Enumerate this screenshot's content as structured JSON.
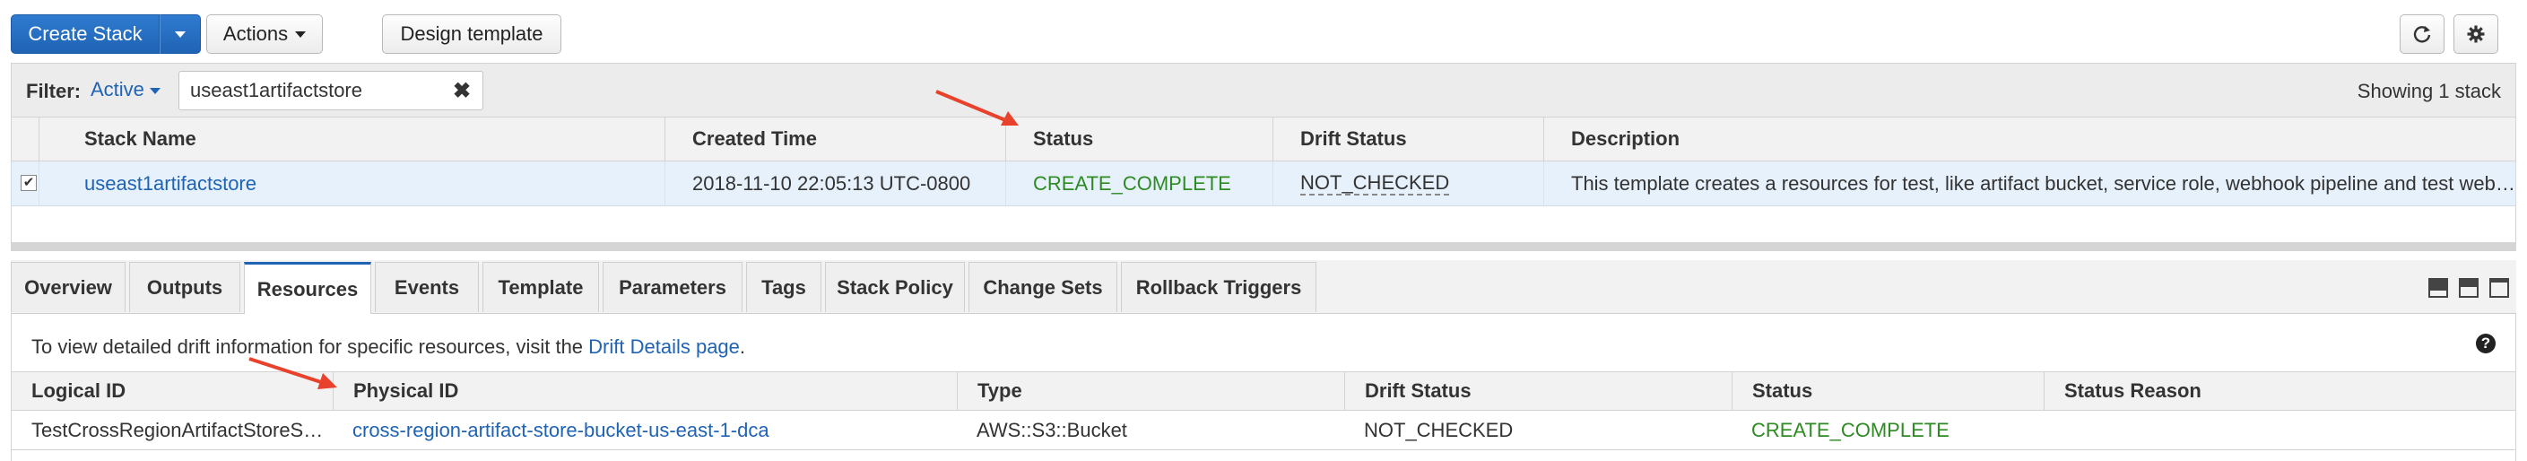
{
  "toolbar": {
    "create_stack": "Create Stack",
    "actions": "Actions",
    "design_template": "Design template",
    "refresh_icon": "refresh-icon",
    "settings_icon": "gear-icon"
  },
  "filter": {
    "label": "Filter:",
    "status_filter": "Active",
    "search_value": "useast1artifactstore",
    "clear_icon": "close-icon",
    "showing": "Showing 1 stack"
  },
  "stacks": {
    "columns": [
      "Stack Name",
      "Created Time",
      "Status",
      "Drift Status",
      "Description"
    ],
    "rows": [
      {
        "selected": true,
        "name": "useast1artifactstore",
        "created": "2018-11-10 22:05:13 UTC-0800",
        "status": "CREATE_COMPLETE",
        "drift": "NOT_CHECKED",
        "description": "This template creates a resources for test, like artifact bucket, service role, webhook pipeline and test web…"
      }
    ]
  },
  "tabs": [
    {
      "label": "Overview",
      "active": false
    },
    {
      "label": "Outputs",
      "active": false
    },
    {
      "label": "Resources",
      "active": true
    },
    {
      "label": "Events",
      "active": false
    },
    {
      "label": "Template",
      "active": false
    },
    {
      "label": "Parameters",
      "active": false
    },
    {
      "label": "Tags",
      "active": false
    },
    {
      "label": "Stack Policy",
      "active": false
    },
    {
      "label": "Change Sets",
      "active": false
    },
    {
      "label": "Rollback Triggers",
      "active": false
    }
  ],
  "resources": {
    "info_text": "To view detailed drift information for specific resources, visit the ",
    "info_link": "Drift Details page",
    "info_end": ".",
    "columns": [
      "Logical ID",
      "Physical ID",
      "Type",
      "Drift Status",
      "Status",
      "Status Reason"
    ],
    "rows": [
      {
        "logical_id": "TestCrossRegionArtifactStoreS…",
        "physical_id": "cross-region-artifact-store-bucket-us-east-1-dca",
        "type": "AWS::S3::Bucket",
        "drift": "NOT_CHECKED",
        "status": "CREATE_COMPLETE",
        "reason": ""
      }
    ]
  },
  "colors": {
    "primary": "#1f63b4",
    "success": "#2e8b24",
    "annotation_arrow": "#e8412c"
  }
}
